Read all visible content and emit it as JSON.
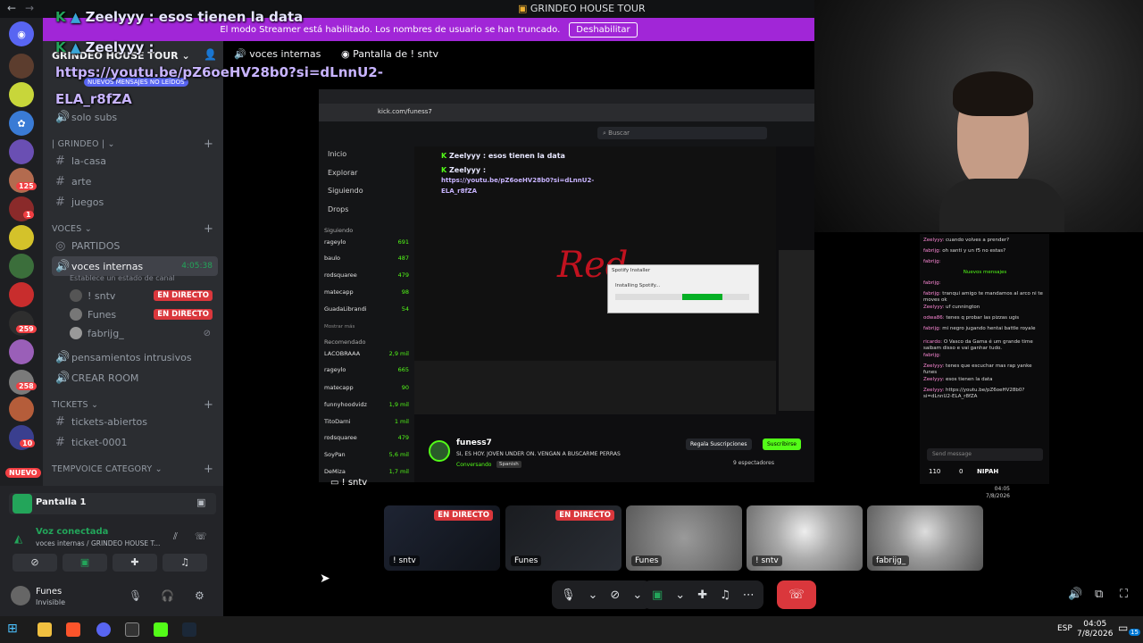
{
  "window": {
    "title": "GRINDEO HOUSE TOUR"
  },
  "banner": {
    "text": "El modo Streamer está habilitado. Los nombres de usuario se han truncado.",
    "button": "Deshabilitar"
  },
  "overlay": {
    "line1_user": "Zeelyyy",
    "line1_msg": ": esos tienen la data",
    "line2_user": "Zeelyyy :",
    "link_a": "https://youtu.be/pZ6oeHV28b0?si=dLnnU2-",
    "link_b": "ELA_r8fZA"
  },
  "header": {
    "server_name": "GRINDEO HOUSE TOUR",
    "channel": "voces internas",
    "screen_share": "Pantalla de ! sntv",
    "new_messages": "NUEVOS MENSAJES NO LEÍDOS"
  },
  "sidebar": {
    "solo_subs": "solo subs",
    "cat_grindeo": "| GRINDEO |",
    "channels": [
      "la-casa",
      "arte",
      "juegos"
    ],
    "cat_voces": "VOCES",
    "partidos": "PARTIDOS",
    "voice_channel": "voces internas",
    "voice_time": "4:05:38",
    "voice_status": "Establece un estado de canal",
    "users": [
      {
        "name": "! sntv",
        "live": "EN DIRECTO"
      },
      {
        "name": "Funes",
        "live": "EN DIRECTO"
      },
      {
        "name": "fabrijg_",
        "live": ""
      }
    ],
    "pensamientos": "pensamientos intrusivos",
    "crear_room": "CREAR ROOM",
    "cat_tickets": "TICKETS",
    "tickets": [
      "tickets-abiertos",
      "ticket-0001"
    ],
    "cat_tempvoice": "TEMPVOICE CATEGORY"
  },
  "rail": {
    "badges": [
      "125",
      "1",
      "259",
      "258",
      "10"
    ],
    "nuevo": "NUEVO"
  },
  "panel": {
    "screen_label": "Pantalla 1",
    "voice_connected": "Voz conectada",
    "voice_location": "voces internas / GRINDEO HOUSE T...",
    "user_name": "Funes",
    "user_status": "Invisible"
  },
  "stream": {
    "url": "kick.com/funess7",
    "search": "Buscar",
    "nav": [
      "Inicio",
      "Explorar",
      "Siguiendo",
      "Drops"
    ],
    "following_title": "Siguiendo",
    "following": [
      {
        "name": "rageylo",
        "n": "691"
      },
      {
        "name": "baulo",
        "n": "487"
      },
      {
        "name": "rodsquaree",
        "n": "479"
      },
      {
        "name": "matecapp",
        "n": "98"
      },
      {
        "name": "GuadaLibrandi",
        "n": "54"
      }
    ],
    "show_more": "Mostrar más",
    "recommended_title": "Recomendado",
    "recommended": [
      {
        "name": "LACOBRAAA",
        "n": "2,9 mil"
      },
      {
        "name": "rageylo",
        "n": "665"
      },
      {
        "name": "matecapp",
        "n": "90"
      },
      {
        "name": "funnyhoodvidz",
        "n": "1,9 mil"
      },
      {
        "name": "TitoDarni",
        "n": "1 mil"
      },
      {
        "name": "rodsquaree",
        "n": "479"
      },
      {
        "name": "SoyPan",
        "n": "5,6 mil"
      },
      {
        "name": "DeMiza",
        "n": "1,7 mil"
      }
    ],
    "installer_title": "Spotify Installer",
    "installer_text": "Installing Spotify...",
    "installer_progress": 0.5,
    "streamer": "funess7",
    "stream_title": "SI, ES HOY. JOVEN UNDER ON. VENGAN A BUSCARME PERRAS",
    "category": "Conversando",
    "language": "Spanish",
    "gift_subs": "Regala Suscripciones",
    "subscribe": "Suscribirse",
    "spectators": "9 espectadores",
    "send_message": "Send message",
    "chat": [
      {
        "user": "Zeelyyy",
        "msg": "cuando volves a prender?"
      },
      {
        "user": "fabrijg",
        "msg": "oh santi y un f5 no estas?"
      },
      {
        "user": "fabrijg",
        "msg": ""
      },
      {
        "user": "",
        "msg": "Nuevos mensajes"
      },
      {
        "user": "fabrijg",
        "msg": ""
      },
      {
        "user": "fabrijg",
        "msg": "tranqui amigo te mandamos al arco ni te moves ok"
      },
      {
        "user": "Zeelyyy",
        "msg": "uf cunnington"
      },
      {
        "user": "odwa86",
        "msg": "tenes q probar las pizzas ugis"
      },
      {
        "user": "fabrijg",
        "msg": "mi negro jugando hentai battle royale"
      },
      {
        "user": "ricardo",
        "msg": "O Vasco da Gama é um grande time saibam disso e vai ganhar tudo."
      },
      {
        "user": "fabrijg",
        "msg": ""
      },
      {
        "user": "Zeelyyy",
        "msg": "tenes que escuchar mas rap yanke funes"
      },
      {
        "user": "Zeelyyy",
        "msg": "esos tienen la data"
      },
      {
        "user": "Zeelyyy",
        "msg": "https://youtu.be/pZ6oeHV28b0?si=dLnnU2-ELA_r8fZA"
      }
    ],
    "points": "110",
    "zero": "0",
    "nipah": "NIPAH",
    "taskbar_time": "04:05",
    "taskbar_date": "7/8/2026"
  },
  "thumbs": [
    {
      "label": "! sntv",
      "live": "EN DIRECTO"
    },
    {
      "label": "Funes",
      "live": "EN DIRECTO"
    },
    {
      "label": "Funes",
      "live": ""
    },
    {
      "label": "! sntv",
      "live": ""
    },
    {
      "label": "fabrijg_",
      "live": ""
    }
  ],
  "stream_label": "! sntv",
  "taskbar": {
    "lang": "ESP",
    "time": "04:05",
    "date": "7/8/2026",
    "notif": "15"
  },
  "colors": {
    "banner": "#a126d7",
    "kick_green": "#53fc18",
    "live_red": "#da373c",
    "discord_green": "#23a55a"
  }
}
